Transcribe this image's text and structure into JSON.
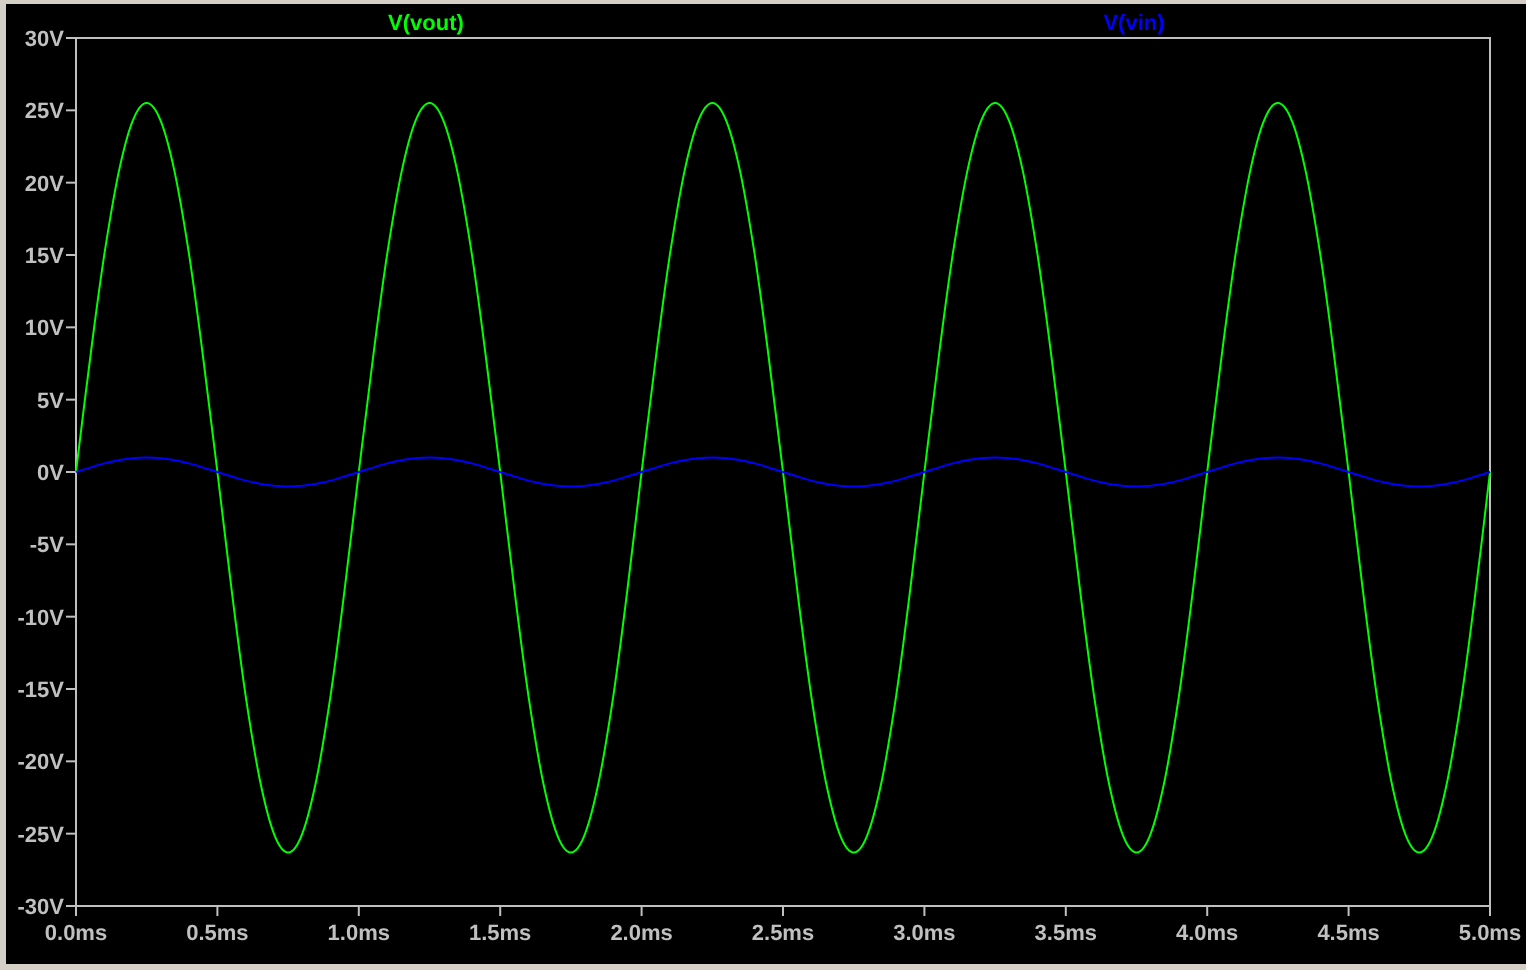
{
  "plot": {
    "chart_data": {
      "type": "line",
      "x": [
        0,
        0.05,
        0.1,
        0.15,
        0.2,
        0.25,
        0.3,
        0.35,
        0.4,
        0.45,
        0.5,
        0.55,
        0.6,
        0.65,
        0.7,
        0.75,
        0.8,
        0.85,
        0.9,
        0.95,
        1,
        1.05,
        1.1,
        1.15,
        1.2,
        1.25,
        1.3,
        1.35,
        1.4,
        1.45,
        1.5,
        1.55,
        1.6,
        1.65,
        1.7,
        1.75,
        1.8,
        1.85,
        1.9,
        1.95,
        2,
        2.05,
        2.1,
        2.15,
        2.2,
        2.25,
        2.3,
        2.35,
        2.4,
        2.45,
        2.5,
        2.55,
        2.6,
        2.65,
        2.7,
        2.75,
        2.8,
        2.85,
        2.9,
        2.95,
        3,
        3.05,
        3.1,
        3.15,
        3.2,
        3.25,
        3.3,
        3.35,
        3.4,
        3.45,
        3.5,
        3.55,
        3.6,
        3.65,
        3.7,
        3.75,
        3.8,
        3.85,
        3.9,
        3.95,
        4,
        4.05,
        4.1,
        4.15,
        4.2,
        4.25,
        4.3,
        4.35,
        4.4,
        4.45,
        4.5,
        4.55,
        4.6,
        4.65,
        4.7,
        4.75,
        4.8,
        4.85,
        4.9,
        4.95,
        5
      ],
      "series": [
        {
          "name": "V(vout)",
          "color": "#00ff00",
          "values": [
            0,
            7.88,
            14.99,
            20.63,
            24.25,
            25.5,
            24.25,
            20.63,
            14.99,
            7.88,
            0,
            -8.13,
            -15.46,
            -21.28,
            -25.01,
            -26.3,
            -25.01,
            -21.28,
            -15.46,
            -8.13,
            0,
            7.88,
            14.99,
            20.63,
            24.25,
            25.5,
            24.25,
            20.63,
            14.99,
            7.88,
            0,
            -8.13,
            -15.46,
            -21.28,
            -25.01,
            -26.3,
            -25.01,
            -21.28,
            -15.46,
            -8.13,
            0,
            7.88,
            14.99,
            20.63,
            24.25,
            25.5,
            24.25,
            20.63,
            14.99,
            7.88,
            0,
            -8.13,
            -15.46,
            -21.28,
            -25.01,
            -26.3,
            -25.01,
            -21.28,
            -15.46,
            -8.13,
            0,
            7.88,
            14.99,
            20.63,
            24.25,
            25.5,
            24.25,
            20.63,
            14.99,
            7.88,
            0,
            -8.13,
            -15.46,
            -21.28,
            -25.01,
            -26.3,
            -25.01,
            -21.28,
            -15.46,
            -8.13,
            0,
            7.88,
            14.99,
            20.63,
            24.25,
            25.5,
            24.25,
            20.63,
            14.99,
            7.88,
            0,
            -8.13,
            -15.46,
            -21.28,
            -25.01,
            -26.3,
            -25.01,
            -21.28,
            -15.46,
            -8.13,
            0
          ]
        },
        {
          "name": "V(vin)",
          "color": "#0000ff",
          "values": [
            0,
            0.31,
            0.59,
            0.81,
            0.95,
            1,
            0.95,
            0.81,
            0.59,
            0.31,
            0,
            -0.31,
            -0.59,
            -0.81,
            -0.95,
            -1,
            -0.95,
            -0.81,
            -0.59,
            -0.31,
            0,
            0.31,
            0.59,
            0.81,
            0.95,
            1,
            0.95,
            0.81,
            0.59,
            0.31,
            0,
            -0.31,
            -0.59,
            -0.81,
            -0.95,
            -1,
            -0.95,
            -0.81,
            -0.59,
            -0.31,
            0,
            0.31,
            0.59,
            0.81,
            0.95,
            1,
            0.95,
            0.81,
            0.59,
            0.31,
            0,
            -0.31,
            -0.59,
            -0.81,
            -0.95,
            -1,
            -0.95,
            -0.81,
            -0.59,
            -0.31,
            0,
            0.31,
            0.59,
            0.81,
            0.95,
            1,
            0.95,
            0.81,
            0.59,
            0.31,
            0,
            -0.31,
            -0.59,
            -0.81,
            -0.95,
            -1,
            -0.95,
            -0.81,
            -0.59,
            -0.31,
            0,
            0.31,
            0.59,
            0.81,
            0.95,
            1,
            0.95,
            0.81,
            0.59,
            0.31,
            0,
            -0.31,
            -0.59,
            -0.81,
            -0.95,
            -1,
            -0.95,
            -0.81,
            -0.59,
            -0.31,
            0
          ]
        }
      ],
      "xlim": [
        0,
        5
      ],
      "ylim": [
        -30,
        30
      ],
      "xticks": [
        {
          "value": 0,
          "label": "0.0ms"
        },
        {
          "value": 0.5,
          "label": "0.5ms"
        },
        {
          "value": 1,
          "label": "1.0ms"
        },
        {
          "value": 1.5,
          "label": "1.5ms"
        },
        {
          "value": 2,
          "label": "2.0ms"
        },
        {
          "value": 2.5,
          "label": "2.5ms"
        },
        {
          "value": 3,
          "label": "3.0ms"
        },
        {
          "value": 3.5,
          "label": "3.5ms"
        },
        {
          "value": 4,
          "label": "4.0ms"
        },
        {
          "value": 4.5,
          "label": "4.5ms"
        },
        {
          "value": 5,
          "label": "5.0ms"
        }
      ],
      "yticks": [
        {
          "value": 30,
          "label": "30V"
        },
        {
          "value": 25,
          "label": "25V"
        },
        {
          "value": 20,
          "label": "20V"
        },
        {
          "value": 15,
          "label": "15V"
        },
        {
          "value": 10,
          "label": "10V"
        },
        {
          "value": 5,
          "label": "5V"
        },
        {
          "value": 0,
          "label": "0V"
        },
        {
          "value": -5,
          "label": "-5V"
        },
        {
          "value": -10,
          "label": "-10V"
        },
        {
          "value": -15,
          "label": "-15V"
        },
        {
          "value": -20,
          "label": "-20V"
        },
        {
          "value": -25,
          "label": "-25V"
        },
        {
          "value": -30,
          "label": "-30V"
        }
      ]
    }
  }
}
